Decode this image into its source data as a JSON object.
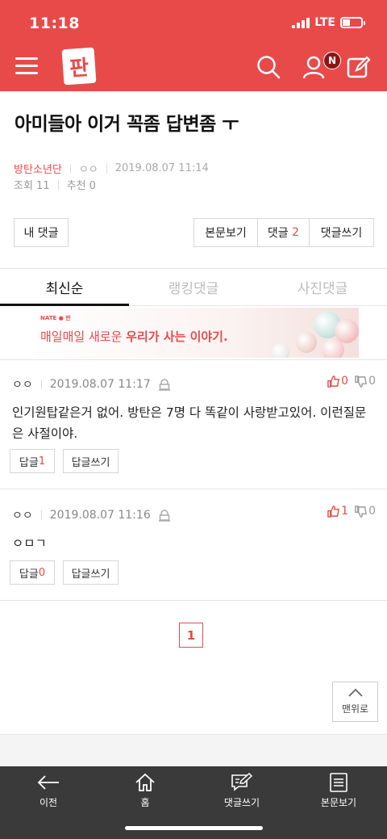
{
  "status": {
    "time": "11:18",
    "network": "LTE"
  },
  "header": {
    "logo_text": "판",
    "notif_badge": "N"
  },
  "post": {
    "title": "아미들아 이거 꼭좀 답변좀 ㅜ",
    "category": "방탄소년단",
    "author": "ㅇㅇ",
    "datetime": "2019.08.07 11:14",
    "views": "조회 11",
    "recommend": "추천 0"
  },
  "actions": {
    "my_comment": "내 댓글",
    "view_body": "본문보기",
    "comments_label": "댓글",
    "comments_count": "2",
    "write_comment": "댓글쓰기"
  },
  "tabs": [
    {
      "label": "최신순",
      "active": true
    },
    {
      "label": "랭킹댓글",
      "active": false
    },
    {
      "label": "사진댓글",
      "active": false
    }
  ],
  "ad": {
    "brand": "NATE ● 판",
    "text_plain": "매일매일 새로운 ",
    "text_bold": "우리가 사는 이야기."
  },
  "comments": [
    {
      "author": "ㅇㅇ",
      "datetime": "2019.08.07 11:17",
      "up": "0",
      "down": "0",
      "body": "인기원탑같은거 없어. 방탄은 7명 다 똑같이 사랑받고있어. 이런질문은 사절이야.",
      "reply_label": "답글",
      "reply_count": "1",
      "write_reply": "답글쓰기"
    },
    {
      "author": "ㅇㅇ",
      "datetime": "2019.08.07 11:16",
      "up": "1",
      "down": "0",
      "body": "ㅇㅁㄱ",
      "reply_label": "답글",
      "reply_count": "0",
      "write_reply": "답글쓰기"
    }
  ],
  "pagination": {
    "current": "1"
  },
  "to_top": "맨위로",
  "bottom_nav": [
    {
      "label": "이전",
      "icon": "back-arrow-icon"
    },
    {
      "label": "홈",
      "icon": "home-icon"
    },
    {
      "label": "댓글쓰기",
      "icon": "comment-write-icon"
    },
    {
      "label": "본문보기",
      "icon": "document-icon"
    }
  ],
  "colors": {
    "brand": "#e84a4a",
    "bottom_bar": "#3a3a3a"
  }
}
